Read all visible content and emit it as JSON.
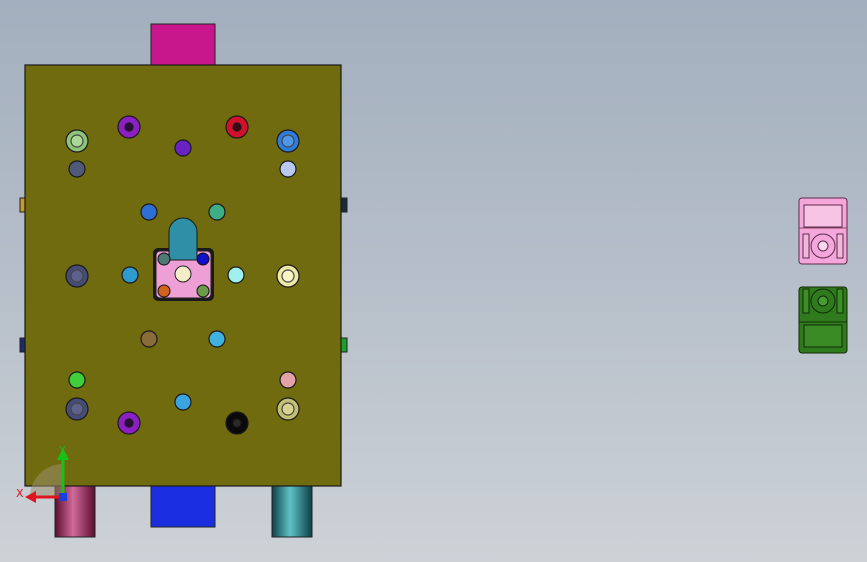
{
  "viewport": {
    "background_top": "#a3afbe",
    "background_bottom": "#cdd2d7"
  },
  "mold_plate": {
    "color": "#6f6b0e",
    "top_block_color": "#c8178c",
    "bottom_block_color": "#1a2ee0",
    "pin_left_color": "#9a1a52",
    "pin_right_color": "#1c6d72",
    "insert_color": "#ee9fd6",
    "slot_color": "#2f8fa6"
  },
  "side_parts": {
    "upper_color": "#f5a6db",
    "lower_color": "#2f7a1c"
  },
  "triad": {
    "x_label": "X",
    "y_label": "Y",
    "x_color": "#e0141e",
    "y_color": "#16c21a",
    "z_color": "#1a3ee0"
  }
}
